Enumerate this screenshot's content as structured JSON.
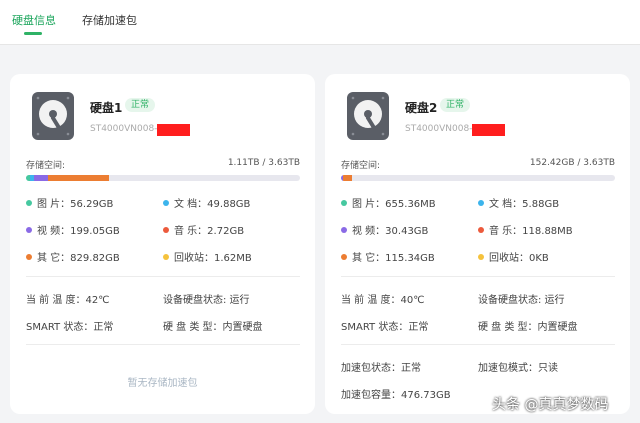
{
  "tabs": [
    "硬盘信息",
    "存储加速包"
  ],
  "colors": {
    "accent": "#2fb266",
    "image": "#46c8a0",
    "doc": "#3cb4ec",
    "video": "#8a6ae6",
    "music": "#ec5a3c",
    "other": "#ec7d32",
    "recycle": "#f5c23c"
  },
  "disks": [
    {
      "name": "硬盘1",
      "status": "正常",
      "model": "ST4000VN008-",
      "storage_label": "存储空间:",
      "storage_value": "1.11TB / 3.63TB",
      "stats": {
        "image": "图 片：56.29GB",
        "doc": "文 档：49.88GB",
        "video": "视 频：199.05GB",
        "music": "音 乐：2.72GB",
        "other": "其 它：829.82GB",
        "recycle": "回收站：1.62MB"
      },
      "temp": "当 前 温 度：42℃",
      "dev_status": "设备硬盘状态: 运行",
      "smart": "SMART 状态：正常",
      "disk_type": "硬 盘 类 型：内置硬盘",
      "no_pack": "暂无存储加速包"
    },
    {
      "name": "硬盘2",
      "status": "正常",
      "model": "ST4000VN008-",
      "storage_label": "存储空间:",
      "storage_value": "152.42GB / 3.63TB",
      "stats": {
        "image": "图 片：655.36MB",
        "doc": "文 档：5.88GB",
        "video": "视 频：30.43GB",
        "music": "音 乐：118.88MB",
        "other": "其 它：115.34GB",
        "recycle": "回收站：0KB"
      },
      "temp": "当 前 温 度：40℃",
      "dev_status": "设备硬盘状态: 运行",
      "smart": "SMART 状态：正常",
      "disk_type": "硬 盘 类 型：内置硬盘",
      "pack_status": "加速包状态：正常",
      "pack_mode": "加速包模式：只读",
      "pack_capacity": "加速包容量：476.73GB"
    }
  ],
  "watermark": "头条 @真真梦数码"
}
